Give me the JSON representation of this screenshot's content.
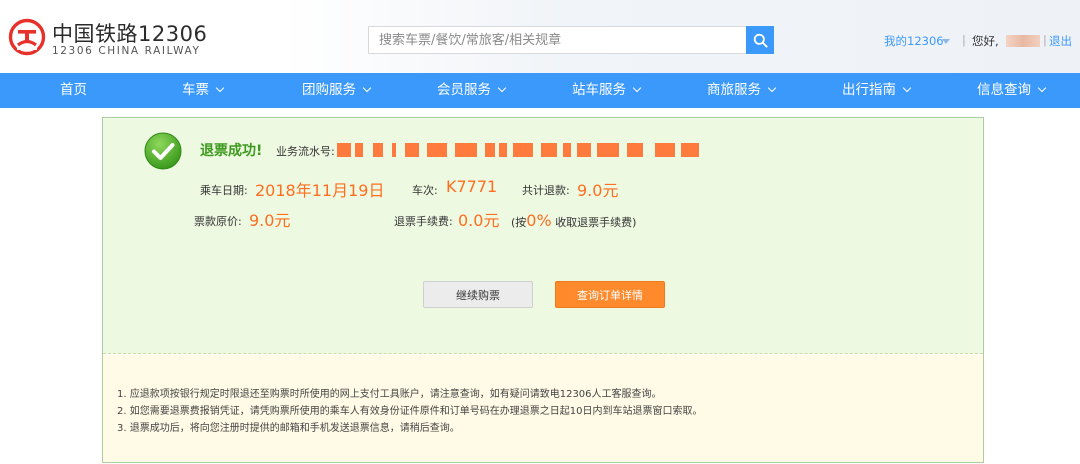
{
  "header": {
    "logo_cn": "中国铁路12306",
    "logo_en": "12306 CHINA RAILWAY",
    "search_placeholder": "搜索车票/餐饮/常旅客/相关规章",
    "my12306": "我的12306",
    "separator": "|",
    "hello": "您好,",
    "logout": "退出",
    "brand_red": "#e8312b",
    "accent_blue": "#3b99fc"
  },
  "nav": {
    "items": [
      {
        "label": "首页",
        "icon": null
      },
      {
        "label": "车票",
        "icon": "chevron-down-icon"
      },
      {
        "label": "团购服务",
        "icon": "chevron-down-icon"
      },
      {
        "label": "会员服务",
        "icon": "chevron-down-icon"
      },
      {
        "label": "站车服务",
        "icon": "chevron-down-icon"
      },
      {
        "label": "商旅服务",
        "icon": "chevron-down-icon"
      },
      {
        "label": "出行指南",
        "icon": "chevron-down-icon"
      },
      {
        "label": "信息查询",
        "icon": "chevron-down-icon"
      }
    ]
  },
  "result": {
    "title": "退票成功!",
    "serial_label": "业务流水号:",
    "travel_date_label": "乘车日期:",
    "travel_date": "2018年11月19日",
    "train_label": "车次:",
    "train_no": "K7771",
    "total_refund_label": "共计退款:",
    "total_refund": "9.0元",
    "original_price_label": "票款原价:",
    "original_price": "9.0元",
    "fee_label": "退票手续费:",
    "fee": "0.0元",
    "rate_prefix": "(按",
    "rate": "0%",
    "rate_suffix": "收取退票手续费)",
    "success_color": "#3c9a1c",
    "value_color": "#ff6e1f"
  },
  "buttons": {
    "continue": "继续购票",
    "query_order": "查询订单详情"
  },
  "notes": [
    "1. 应退款项按银行规定时限退还至购票时所使用的网上支付工具账户，请注意查询，如有疑问请致电12306人工客服查询。",
    "2. 如您需要退票费报销凭证，请凭购票所使用的乘车人有效身份证件原件和订单号码在办理退票之日起10日内到车站退票窗口索取。",
    "3. 退票成功后，将向您注册时提供的邮箱和手机发送退票信息，请稍后查询。"
  ]
}
